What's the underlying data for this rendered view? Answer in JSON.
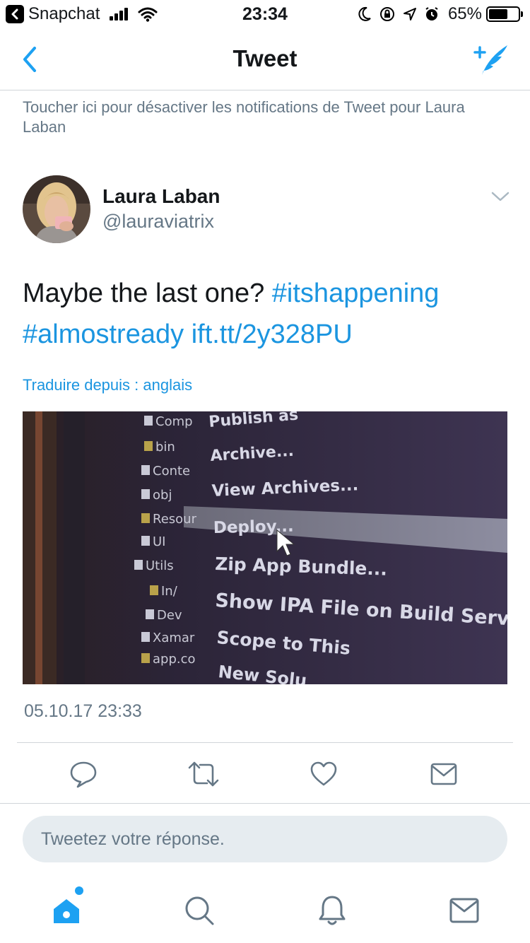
{
  "status_bar": {
    "app": "Snapchat",
    "time": "23:34",
    "battery": "65%",
    "battery_level": 0.65,
    "icons": [
      "back-chevron-icon",
      "signal-icon",
      "wifi-icon",
      "moon-icon",
      "rotation-lock-icon",
      "location-icon",
      "alarm-icon",
      "battery-icon"
    ]
  },
  "nav": {
    "title": "Tweet",
    "back_icon": "chevron-left-icon",
    "compose_icon": "compose-tweet-icon"
  },
  "notification_text": "Toucher ici pour désactiver les notifications de Tweet pour Laura Laban",
  "author": {
    "name": "Laura Laban",
    "handle": "@lauraviatrix"
  },
  "tweet": {
    "text": "Maybe the last one?",
    "hashtag1": "#itshappening",
    "hashtag2": "#almostready",
    "link": "ift.tt/2y328PU",
    "translate": "Traduire depuis : anglais",
    "timestamp": "05.10.17 23:33"
  },
  "media": {
    "sidebar_items": [
      "Comp",
      "bin",
      "Conte",
      "obj",
      "Resour",
      "UI",
      "Utils",
      "In/",
      "Dev",
      "Xamar",
      "app.co"
    ],
    "menu_items": [
      "Publish as",
      "Archive...",
      "View Archives...",
      "Deploy...",
      "Zip App Bundle...",
      "Show IPA File on Build Server",
      "Scope to This",
      "New Solu"
    ]
  },
  "actions": [
    "reply-icon",
    "retweet-icon",
    "like-icon",
    "direct-message-icon"
  ],
  "reply_placeholder": "Tweetez votre réponse.",
  "tabs": [
    "home-icon",
    "search-icon",
    "notifications-icon",
    "messages-icon"
  ],
  "colors": {
    "accent": "#1da1f2",
    "link": "#1b95e0",
    "secondary_text": "#657786",
    "divider": "#d0d5d9"
  }
}
